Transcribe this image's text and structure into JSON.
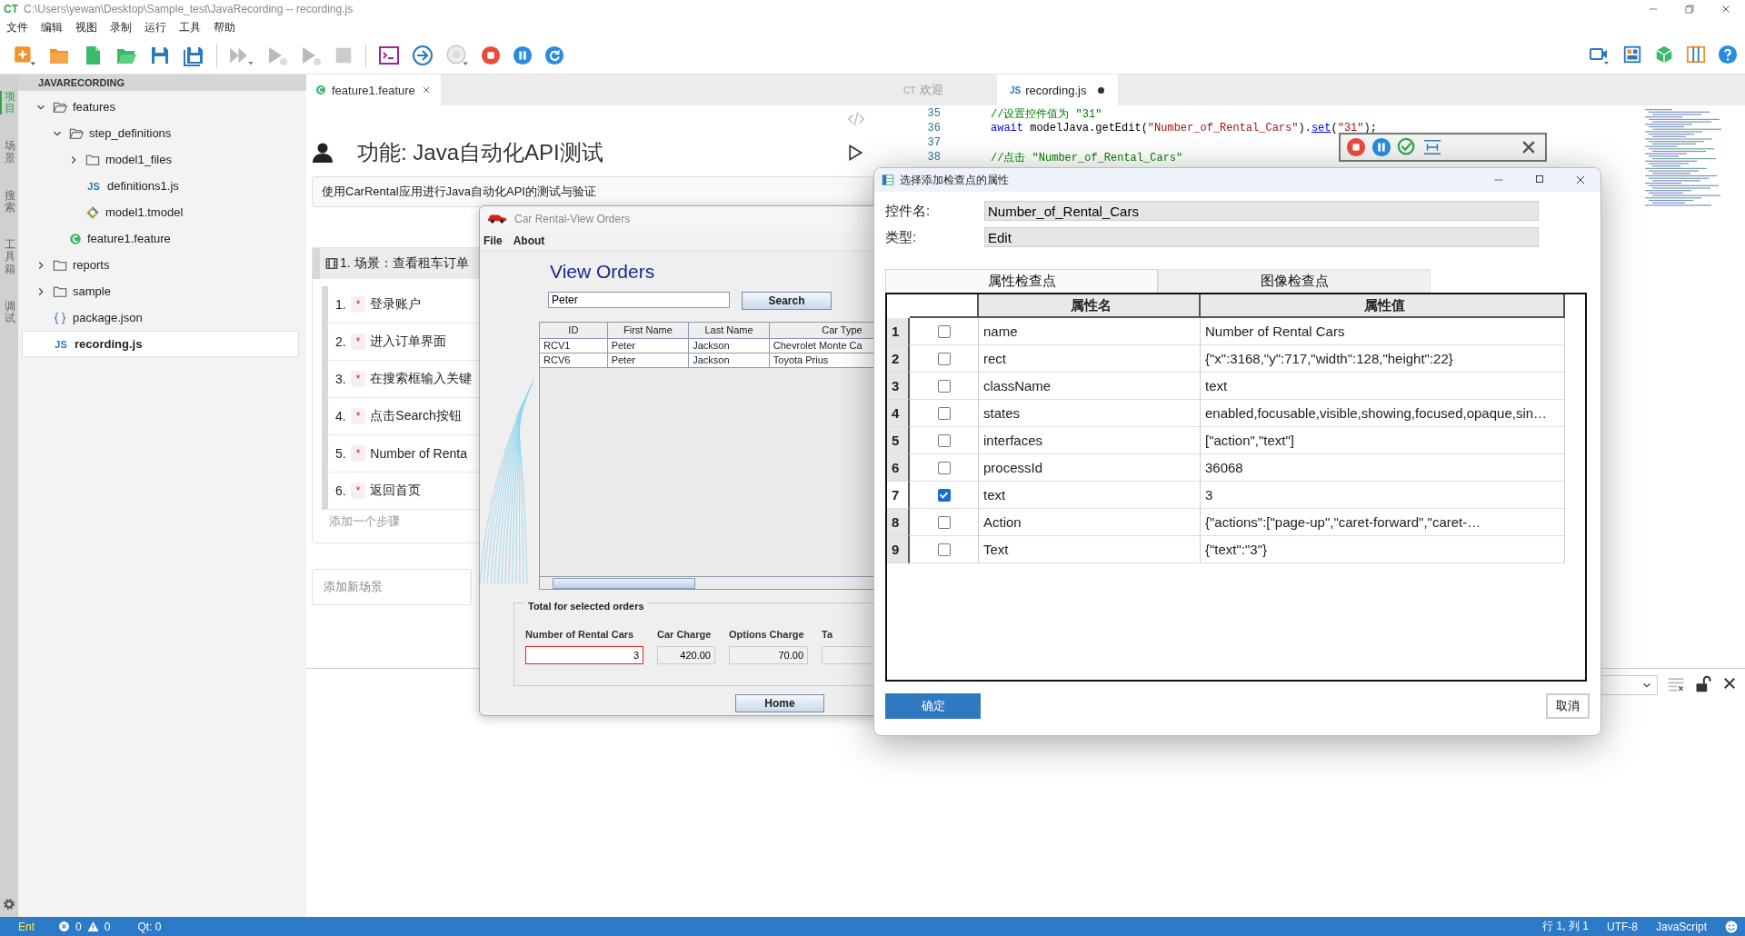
{
  "window": {
    "logo": "CT",
    "title": "C:\\Users\\yewan\\Desktop\\Sample_test\\JavaRecording -- recording.js"
  },
  "menu": [
    "文件",
    "编辑",
    "视图",
    "录制",
    "运行",
    "工具",
    "帮助"
  ],
  "activity_tabs": [
    {
      "label": "项目",
      "selected": true
    },
    {
      "label": "场景",
      "selected": false
    },
    {
      "label": "搜索",
      "selected": false
    },
    {
      "label": "工具箱",
      "selected": false
    },
    {
      "label": "调试",
      "selected": false
    }
  ],
  "explorer": {
    "title": "JAVARECORDING",
    "tree": [
      {
        "label": "features",
        "kind": "folder",
        "expanded": true,
        "selected": false,
        "children": [
          {
            "label": "step_definitions",
            "kind": "folder",
            "expanded": true,
            "selected": false,
            "children": [
              {
                "label": "model1_files",
                "kind": "folder",
                "expanded": false,
                "selected": false
              },
              {
                "label": "definitions1.js",
                "kind": "js",
                "badge": "JS",
                "selected": false
              },
              {
                "label": "model1.tmodel",
                "kind": "model",
                "selected": false
              }
            ]
          },
          {
            "label": "feature1.feature",
            "kind": "feature",
            "selected": false
          }
        ]
      },
      {
        "label": "reports",
        "kind": "folder",
        "expanded": false,
        "selected": false
      },
      {
        "label": "sample",
        "kind": "folder",
        "expanded": false,
        "selected": false
      },
      {
        "label": "package.json",
        "kind": "json",
        "selected": false
      },
      {
        "label": "recording.js",
        "kind": "js",
        "badge": "JS",
        "selected": true
      }
    ]
  },
  "feature_tabs": [
    {
      "label": "feature1.feature",
      "selected": true
    }
  ],
  "feature": {
    "title": "功能: Java自动化API测试",
    "description": "使用CarRental应用进行Java自动化API的测试与验证",
    "scenario": {
      "title": "1. 场景：查看租车订单",
      "steps": [
        {
          "number": "1.",
          "keyword": "*",
          "text": "登录账户"
        },
        {
          "number": "2.",
          "keyword": "*",
          "text": "进入订单界面"
        },
        {
          "number": "3.",
          "keyword": "*",
          "text": "在搜索框输入关键"
        },
        {
          "number": "4.",
          "keyword": "*",
          "text": "点击Search按钮"
        },
        {
          "number": "5.",
          "keyword": "*",
          "text": "Number of Renta"
        },
        {
          "number": "6.",
          "keyword": "*",
          "text": "返回首页"
        }
      ],
      "add_step": "添加一个步骤"
    },
    "add_scenario": "添加新场景"
  },
  "editor": {
    "tabs": [
      {
        "badge": "CT",
        "label": "欢迎",
        "selected": false,
        "modified": false
      },
      {
        "badge": "JS",
        "label": "recording.js",
        "selected": true,
        "modified": true
      }
    ],
    "lines": [
      {
        "number": "35",
        "tokens": [
          {
            "text": "//设置控件值为 \"31\"",
            "kind": "comment"
          }
        ]
      },
      {
        "number": "36",
        "tokens": [
          {
            "text": "await",
            "kind": "keyword"
          },
          {
            "text": " modelJava.getEdit(",
            "kind": "plain"
          },
          {
            "text": "\"Number_of_Rental_Cars\"",
            "kind": "string"
          },
          {
            "text": ").",
            "kind": "plain"
          },
          {
            "text": "set",
            "kind": "method"
          },
          {
            "text": "(",
            "kind": "plain"
          },
          {
            "text": "\"31\"",
            "kind": "string"
          },
          {
            "text": ");",
            "kind": "plain"
          }
        ]
      },
      {
        "number": "37"
      },
      {
        "number": "38",
        "tokens": [
          {
            "text": "//点击 \"Number_of_Rental_Cars\"",
            "kind": "comment"
          }
        ]
      }
    ]
  },
  "car_rental": {
    "title": "Car Rental-View Orders",
    "menu": [
      "File",
      "About"
    ],
    "heading": "View Orders",
    "search_value": "Peter",
    "search_button": "Search",
    "columns": [
      "ID",
      "First Name",
      "Last Name",
      "Car Type"
    ],
    "rows": [
      [
        "RCV1",
        "Peter",
        "Jackson",
        "Chevrolet Monte Ca"
      ],
      [
        "RCV6",
        "Peter",
        "Jackson",
        "Toyota Prius"
      ]
    ],
    "totals_title": "Total for selected orders",
    "totals": [
      {
        "label": "Number of Rental Cars",
        "value": "3",
        "focused": true
      },
      {
        "label": "Car Charge",
        "value": "420.00",
        "focused": false
      },
      {
        "label": "Options Charge",
        "value": "70.00",
        "focused": false
      },
      {
        "label": "Ta",
        "focused": false
      }
    ],
    "home_button": "Home"
  },
  "dialog": {
    "title": "选择添加检查点的属性",
    "fields": [
      {
        "label": "控件名:",
        "value": "Number_of_Rental_Cars"
      },
      {
        "label": "类型:",
        "value": "Edit"
      }
    ],
    "tabs": [
      {
        "label": "属性检查点",
        "selected": true
      },
      {
        "label": "图像检查点",
        "selected": false
      }
    ],
    "columns": [
      "属性名",
      "属性值"
    ],
    "rows": [
      {
        "number": "1",
        "checked": false,
        "selected": false,
        "name": "name",
        "value": "Number of Rental Cars"
      },
      {
        "number": "2",
        "checked": false,
        "selected": false,
        "name": "rect",
        "value": "{\"x\":3168,\"y\":717,\"width\":128,\"height\":22}"
      },
      {
        "number": "3",
        "checked": false,
        "selected": false,
        "name": "className",
        "value": "text"
      },
      {
        "number": "4",
        "checked": false,
        "selected": false,
        "name": "states",
        "value": "enabled,focusable,visible,showing,focused,opaque,sin…"
      },
      {
        "number": "5",
        "checked": false,
        "selected": false,
        "name": "interfaces",
        "value": "[\"action\",\"text\"]"
      },
      {
        "number": "6",
        "checked": false,
        "selected": false,
        "name": "processId",
        "value": "36068"
      },
      {
        "number": "7",
        "checked": true,
        "selected": true,
        "name": "text",
        "value": "3"
      },
      {
        "number": "8",
        "checked": false,
        "selected": false,
        "name": "Action",
        "value": "{\"actions\":[\"page-up\",\"caret-forward\",\"caret-…"
      },
      {
        "number": "9",
        "checked": false,
        "selected": false,
        "name": "Text",
        "value": "{\"text\":\"3\"}"
      }
    ],
    "ok": "确定",
    "cancel": "取消"
  },
  "status_bar": {
    "mode": "Ent",
    "errors": "0",
    "warnings": "0",
    "qt": "Qt: 0",
    "position": "行 1, 列 1",
    "encoding": "UTF-8",
    "language": "JavaScript"
  }
}
